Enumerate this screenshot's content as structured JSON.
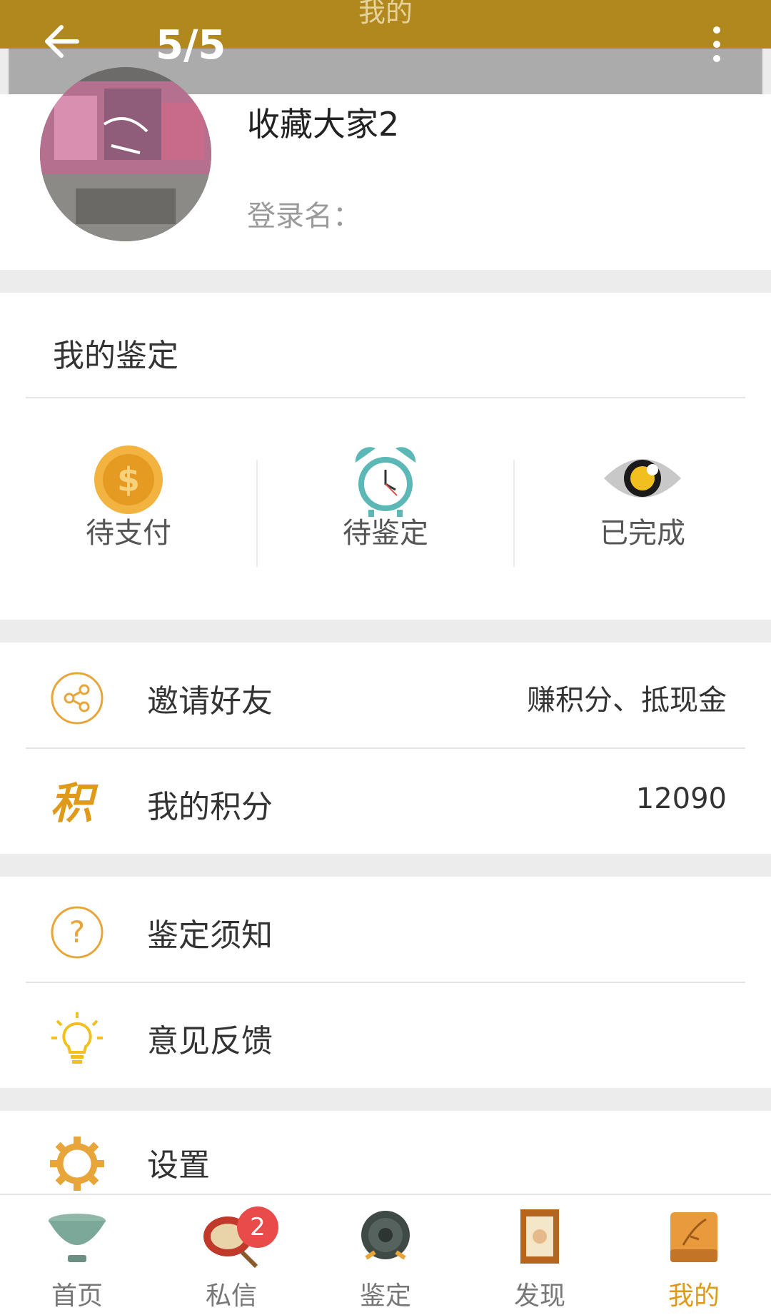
{
  "appbar": {
    "title": "我的"
  },
  "gallery": {
    "counter": "5/5"
  },
  "profile": {
    "nickname": "收藏大家2",
    "login_label": "登录名："
  },
  "appraisal": {
    "title": "我的鉴定",
    "statuses": [
      {
        "label": "待支付",
        "icon": "dollar-coin-icon"
      },
      {
        "label": "待鉴定",
        "icon": "alarm-clock-icon"
      },
      {
        "label": "已完成",
        "icon": "eye-icon"
      }
    ]
  },
  "menu": {
    "invite": {
      "label": "邀请好友",
      "value": "赚积分、抵现金",
      "icon": "share-icon"
    },
    "points": {
      "label": "我的积分",
      "value": "12090",
      "icon": "points-icon",
      "icon_char": "积"
    },
    "notice": {
      "label": "鉴定须知",
      "icon": "question-icon"
    },
    "feedback": {
      "label": "意见反馈",
      "icon": "lightbulb-icon"
    },
    "settings": {
      "label": "设置",
      "icon": "gear-icon"
    }
  },
  "bottom_nav": {
    "items": [
      {
        "label": "首页",
        "icon": "bowl-icon"
      },
      {
        "label": "私信",
        "icon": "drum-icon",
        "badge": "2"
      },
      {
        "label": "鉴定",
        "icon": "bronze-mirror-icon"
      },
      {
        "label": "发现",
        "icon": "scroll-frame-icon"
      },
      {
        "label": "我的",
        "icon": "bamboo-book-icon",
        "active": true
      }
    ]
  },
  "colors": {
    "brand": "#b0881e",
    "accent_orange": "#e8a53a",
    "active_tab": "#e09a1a",
    "badge_red": "#e94b4b",
    "clock_teal": "#5bb8b6"
  }
}
